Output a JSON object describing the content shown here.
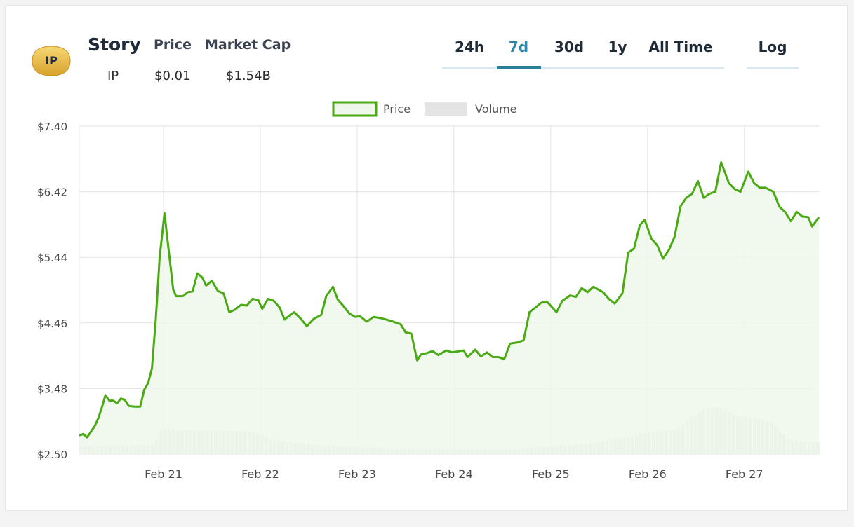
{
  "coin": {
    "name": "Story",
    "symbol": "IP",
    "logo_text": "IP",
    "price_label": "Price",
    "price_value": "$0.01",
    "marketcap_label": "Market Cap",
    "marketcap_value": "$1.54B"
  },
  "range_tabs": [
    {
      "label": "24h",
      "active": false
    },
    {
      "label": "7d",
      "active": true
    },
    {
      "label": "30d",
      "active": false
    },
    {
      "label": "1y",
      "active": false
    },
    {
      "label": "All Time",
      "active": false
    }
  ],
  "log_toggle": {
    "label": "Log"
  },
  "colors": {
    "price_line": "#4aaa14",
    "price_fill": "#eff7ea",
    "volume_bar": "#dadada",
    "active_tab": "#2f86a6",
    "grid": "#e3e3e3"
  },
  "chart_data": {
    "type": "line",
    "legend": [
      {
        "name": "Price",
        "marker": "line"
      },
      {
        "name": "Volume",
        "marker": "bar"
      }
    ],
    "legend_position": "top-center",
    "grid": true,
    "y_ticks": [
      "$7.40",
      "$6.42",
      "$5.44",
      "$4.46",
      "$3.48",
      "$2.50"
    ],
    "ylim": [
      2.5,
      7.4
    ],
    "x_ticks": [
      {
        "label": "Feb 21",
        "day": 21
      },
      {
        "label": "Feb 22",
        "day": 22
      },
      {
        "label": "Feb 23",
        "day": 23
      },
      {
        "label": "Feb 24",
        "day": 24
      },
      {
        "label": "Feb 25",
        "day": 25
      },
      {
        "label": "Feb 26",
        "day": 26
      },
      {
        "label": "Feb 27",
        "day": 27
      }
    ],
    "xlim": [
      20.13,
      27.77
    ],
    "series": [
      {
        "name": "Price",
        "points": [
          [
            20.13,
            2.78
          ],
          [
            20.17,
            2.8
          ],
          [
            20.21,
            2.75
          ],
          [
            20.29,
            2.92
          ],
          [
            20.33,
            3.05
          ],
          [
            20.37,
            3.23
          ],
          [
            20.4,
            3.38
          ],
          [
            20.44,
            3.3
          ],
          [
            20.48,
            3.3
          ],
          [
            20.52,
            3.26
          ],
          [
            20.56,
            3.33
          ],
          [
            20.6,
            3.31
          ],
          [
            20.64,
            3.22
          ],
          [
            20.7,
            3.21
          ],
          [
            20.76,
            3.21
          ],
          [
            20.8,
            3.46
          ],
          [
            20.84,
            3.56
          ],
          [
            20.88,
            3.78
          ],
          [
            20.92,
            4.52
          ],
          [
            20.96,
            5.44
          ],
          [
            21.01,
            6.1
          ],
          [
            21.04,
            5.72
          ],
          [
            21.1,
            4.96
          ],
          [
            21.13,
            4.86
          ],
          [
            21.2,
            4.86
          ],
          [
            21.25,
            4.92
          ],
          [
            21.3,
            4.93
          ],
          [
            21.35,
            5.2
          ],
          [
            21.4,
            5.14
          ],
          [
            21.44,
            5.02
          ],
          [
            21.5,
            5.09
          ],
          [
            21.56,
            4.94
          ],
          [
            21.62,
            4.9
          ],
          [
            21.68,
            4.62
          ],
          [
            21.74,
            4.66
          ],
          [
            21.8,
            4.73
          ],
          [
            21.86,
            4.72
          ],
          [
            21.92,
            4.82
          ],
          [
            21.98,
            4.8
          ],
          [
            22.02,
            4.67
          ],
          [
            22.08,
            4.82
          ],
          [
            22.14,
            4.79
          ],
          [
            22.2,
            4.69
          ],
          [
            22.25,
            4.51
          ],
          [
            22.31,
            4.58
          ],
          [
            22.35,
            4.62
          ],
          [
            22.42,
            4.52
          ],
          [
            22.48,
            4.41
          ],
          [
            22.55,
            4.52
          ],
          [
            22.63,
            4.58
          ],
          [
            22.68,
            4.86
          ],
          [
            22.75,
            5.0
          ],
          [
            22.8,
            4.81
          ],
          [
            22.86,
            4.71
          ],
          [
            22.92,
            4.6
          ],
          [
            22.98,
            4.55
          ],
          [
            23.03,
            4.56
          ],
          [
            23.1,
            4.48
          ],
          [
            23.17,
            4.55
          ],
          [
            23.25,
            4.53
          ],
          [
            23.35,
            4.49
          ],
          [
            23.45,
            4.44
          ],
          [
            23.5,
            4.32
          ],
          [
            23.56,
            4.3
          ],
          [
            23.62,
            3.9
          ],
          [
            23.66,
            3.99
          ],
          [
            23.72,
            4.01
          ],
          [
            23.78,
            4.04
          ],
          [
            23.84,
            3.98
          ],
          [
            23.92,
            4.05
          ],
          [
            23.98,
            4.02
          ],
          [
            24.1,
            4.05
          ],
          [
            24.14,
            3.95
          ],
          [
            24.22,
            4.06
          ],
          [
            24.28,
            3.96
          ],
          [
            24.34,
            4.02
          ],
          [
            24.4,
            3.95
          ],
          [
            24.46,
            3.95
          ],
          [
            24.52,
            3.92
          ],
          [
            24.58,
            4.15
          ],
          [
            24.66,
            4.17
          ],
          [
            24.72,
            4.2
          ],
          [
            24.78,
            4.62
          ],
          [
            24.85,
            4.7
          ],
          [
            24.9,
            4.76
          ],
          [
            24.96,
            4.78
          ],
          [
            25.06,
            4.62
          ],
          [
            25.12,
            4.79
          ],
          [
            25.2,
            4.87
          ],
          [
            25.26,
            4.85
          ],
          [
            25.32,
            4.98
          ],
          [
            25.38,
            4.92
          ],
          [
            25.44,
            5.0
          ],
          [
            25.54,
            4.92
          ],
          [
            25.6,
            4.82
          ],
          [
            25.66,
            4.75
          ],
          [
            25.74,
            4.9
          ],
          [
            25.8,
            5.51
          ],
          [
            25.86,
            5.57
          ],
          [
            25.92,
            5.92
          ],
          [
            25.97,
            6.0
          ],
          [
            26.04,
            5.72
          ],
          [
            26.1,
            5.62
          ],
          [
            26.16,
            5.42
          ],
          [
            26.22,
            5.55
          ],
          [
            26.28,
            5.75
          ],
          [
            26.34,
            6.2
          ],
          [
            26.4,
            6.33
          ],
          [
            26.46,
            6.39
          ],
          [
            26.52,
            6.58
          ],
          [
            26.58,
            6.33
          ],
          [
            26.64,
            6.39
          ],
          [
            26.7,
            6.42
          ],
          [
            26.76,
            6.86
          ],
          [
            26.84,
            6.55
          ],
          [
            26.9,
            6.46
          ],
          [
            26.96,
            6.42
          ],
          [
            27.04,
            6.72
          ],
          [
            27.1,
            6.55
          ],
          [
            27.16,
            6.48
          ],
          [
            27.22,
            6.48
          ],
          [
            27.3,
            6.42
          ],
          [
            27.36,
            6.2
          ],
          [
            27.42,
            6.12
          ],
          [
            27.48,
            5.98
          ],
          [
            27.54,
            6.12
          ],
          [
            27.6,
            6.05
          ],
          [
            27.66,
            6.04
          ],
          [
            27.7,
            5.9
          ],
          [
            27.77,
            6.04
          ]
        ]
      },
      {
        "name": "Volume",
        "points": [
          [
            20.13,
            2.61
          ],
          [
            20.4,
            2.63
          ],
          [
            20.7,
            2.63
          ],
          [
            20.9,
            2.64
          ],
          [
            20.98,
            2.88
          ],
          [
            21.2,
            2.86
          ],
          [
            21.6,
            2.85
          ],
          [
            21.9,
            2.84
          ],
          [
            22.0,
            2.8
          ],
          [
            22.1,
            2.72
          ],
          [
            22.3,
            2.68
          ],
          [
            22.6,
            2.64
          ],
          [
            22.9,
            2.61
          ],
          [
            23.3,
            2.59
          ],
          [
            23.6,
            2.58
          ],
          [
            24.0,
            2.57
          ],
          [
            24.5,
            2.57
          ],
          [
            24.8,
            2.6
          ],
          [
            25.1,
            2.62
          ],
          [
            25.4,
            2.66
          ],
          [
            25.6,
            2.71
          ],
          [
            25.8,
            2.76
          ],
          [
            26.0,
            2.82
          ],
          [
            26.3,
            2.87
          ],
          [
            26.45,
            3.04
          ],
          [
            26.6,
            3.19
          ],
          [
            26.75,
            3.2
          ],
          [
            26.9,
            3.08
          ],
          [
            27.1,
            3.04
          ],
          [
            27.3,
            2.96
          ],
          [
            27.45,
            2.73
          ],
          [
            27.6,
            2.69
          ],
          [
            27.77,
            2.68
          ]
        ]
      }
    ]
  }
}
